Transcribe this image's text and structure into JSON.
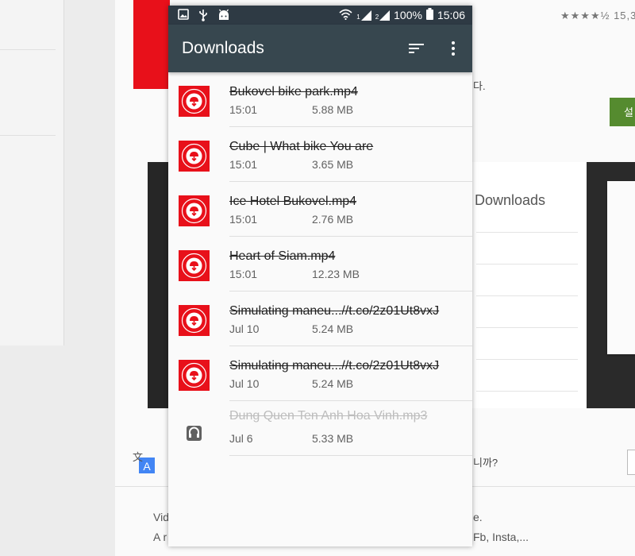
{
  "status_bar": {
    "battery": "100%",
    "time": "15:06",
    "signal_1": "1",
    "signal_2": "2"
  },
  "app_bar": {
    "title": "Downloads"
  },
  "downloads": [
    {
      "name": "Bukovel bike park.mp4",
      "time": "15:01",
      "size": "5.88 MB",
      "icon": "video-thumb-icon"
    },
    {
      "name": "Cube | What bike You are",
      "time": "15:01",
      "size": "3.65 MB",
      "icon": "video-thumb-icon"
    },
    {
      "name": "Ice Hotel Bukovel.mp4",
      "time": "15:01",
      "size": "2.76 MB",
      "icon": "video-thumb-icon"
    },
    {
      "name": "Heart of Siam.mp4",
      "time": "15:01",
      "size": "12.23 MB",
      "icon": "video-thumb-icon"
    },
    {
      "name": "Simulating maneu...//t.co/2z01Ut8vxJ",
      "time": "Jul 10",
      "size": "5.24 MB",
      "icon": "video-thumb-icon"
    },
    {
      "name": "Simulating maneu...//t.co/2z01Ut8vxJ",
      "time": "Jul 10",
      "size": "5.24 MB",
      "icon": "video-thumb-icon"
    },
    {
      "name": "Dung Quen Ten Anh Hoa Vinh.mp3",
      "time": "Jul 6",
      "size": "5.33 MB",
      "icon": "headphones-icon"
    }
  ],
  "background": {
    "screenshot_title": "Downloads",
    "kr_text_1": "다.",
    "kr_text_2": "니까?",
    "install_label": "설",
    "stars": "★★★★½ 15,3",
    "desc_left_1": "Vid",
    "desc_left_2": "A r",
    "desc_right_1": "e.",
    "desc_right_2": "Fb, Insta,..."
  },
  "colors": {
    "appbar": "#37474f",
    "statusbar": "#2e3a44",
    "thumb_red": "#e8101a",
    "install_green": "#558b2f"
  }
}
